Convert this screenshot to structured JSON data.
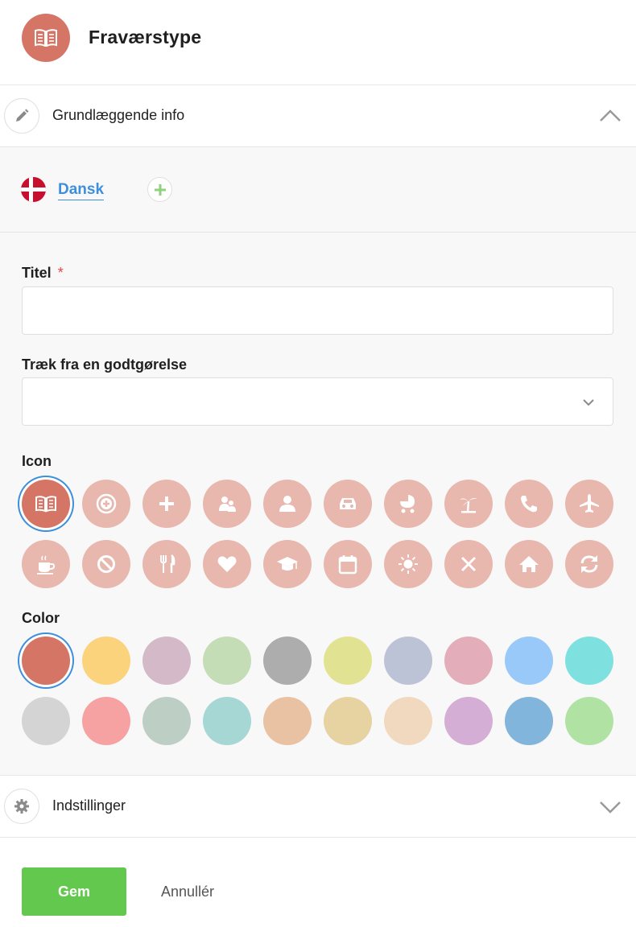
{
  "header": {
    "title": "Fraværstype",
    "icon": "book-icon",
    "icon_color": "#d57565"
  },
  "section_basic": {
    "label": "Grundlæggende info",
    "icon": "pencil-icon",
    "state": "expanded"
  },
  "languages": {
    "current": "Dansk",
    "flag": "denmark-flag-icon",
    "add_icon": "plus-icon"
  },
  "form": {
    "title_label": "Titel",
    "required_marker": "*",
    "title_value": "",
    "deduct_label": "Træk fra en godtgørelse",
    "deduct_value": "",
    "icon_label": "Icon",
    "color_label": "Color"
  },
  "icons": [
    "book-icon",
    "first-aid-icon",
    "plus-icon",
    "people-icon",
    "person-icon",
    "car-icon",
    "stroller-icon",
    "palm-tree-icon",
    "phone-icon",
    "airplane-icon",
    "coffee-icon",
    "block-icon",
    "cutlery-icon",
    "heart-icon",
    "graduation-cap-icon",
    "calendar-icon",
    "sun-icon",
    "close-icon",
    "home-icon",
    "refresh-icon"
  ],
  "selected_icon": "book-icon",
  "icon_colors": {
    "normal": "#e8b7ae",
    "selected": "#d57565"
  },
  "colors": [
    "#d57565",
    "#fbd37c",
    "#d4b9c9",
    "#c5ddb6",
    "#adadad",
    "#e1e393",
    "#bdc3d6",
    "#e3aeba",
    "#99c9f8",
    "#7fe0e0",
    "#d4d4d4",
    "#f6a1a2",
    "#bdcfc5",
    "#a7d7d4",
    "#e9c2a3",
    "#e6d3a1",
    "#f1d9bf",
    "#d4aed4",
    "#81b5dc",
    "#b0e3a3"
  ],
  "selected_color": "#d57565",
  "section_settings": {
    "label": "Indstillinger",
    "icon": "gear-icon",
    "state": "collapsed"
  },
  "actions": {
    "save_label": "Gem",
    "cancel_label": "Annullér",
    "save_color": "#62c94e"
  }
}
